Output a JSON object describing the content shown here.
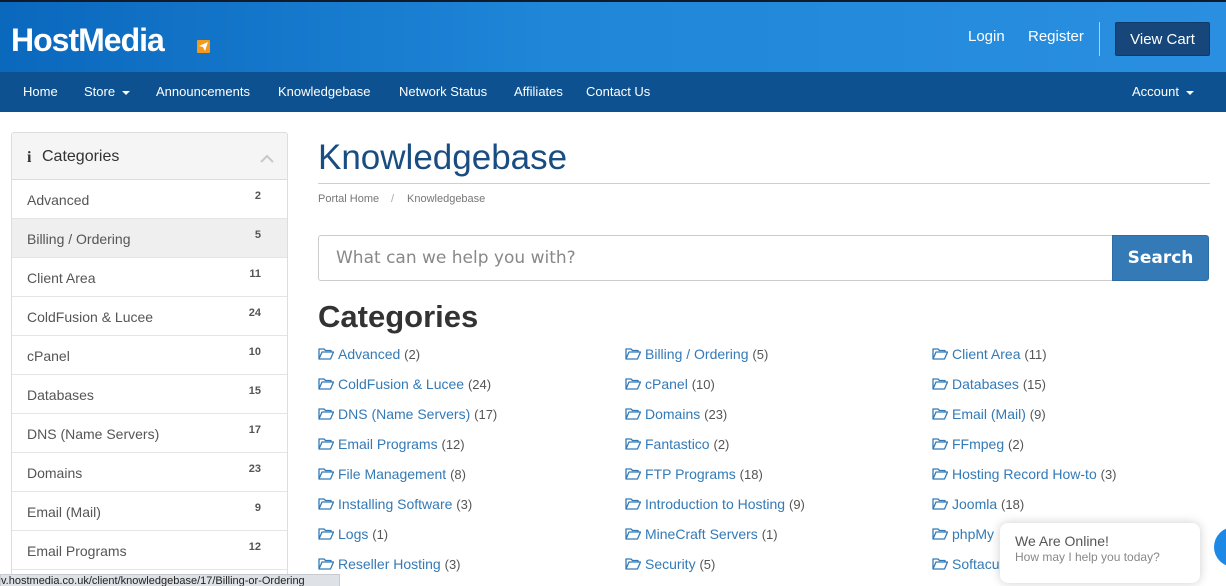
{
  "header": {
    "logo": "HostMedia",
    "login": "Login",
    "register": "Register",
    "view_cart": "View Cart"
  },
  "nav": {
    "items": [
      "Home",
      "Store",
      "Announcements",
      "Knowledgebase",
      "Network Status",
      "Affiliates",
      "Contact Us"
    ],
    "account": "Account"
  },
  "sidebar": {
    "info_glyph": "i",
    "title": "Categories",
    "items": [
      {
        "label": "Advanced",
        "count": "2"
      },
      {
        "label": "Billing / Ordering",
        "count": "5"
      },
      {
        "label": "Client Area",
        "count": "11"
      },
      {
        "label": "ColdFusion & Lucee",
        "count": "24"
      },
      {
        "label": "cPanel",
        "count": "10"
      },
      {
        "label": "Databases",
        "count": "15"
      },
      {
        "label": "DNS (Name Servers)",
        "count": "17"
      },
      {
        "label": "Domains",
        "count": "23"
      },
      {
        "label": "Email (Mail)",
        "count": "9"
      },
      {
        "label": "Email Programs",
        "count": "12"
      }
    ]
  },
  "main": {
    "title": "Knowledgebase",
    "breadcrumb": [
      "Portal Home",
      "Knowledgebase"
    ],
    "breadcrumb_sep": "/",
    "search_placeholder": "What can we help you with?",
    "search_button": "Search",
    "categories_heading": "Categories",
    "categories": [
      {
        "label": "Advanced",
        "count": "(2)"
      },
      {
        "label": "Billing / Ordering",
        "count": "(5)"
      },
      {
        "label": "Client Area",
        "count": "(11)"
      },
      {
        "label": "ColdFusion & Lucee",
        "count": "(24)"
      },
      {
        "label": "cPanel",
        "count": "(10)"
      },
      {
        "label": "Databases",
        "count": "(15)"
      },
      {
        "label": "DNS (Name Servers)",
        "count": "(17)"
      },
      {
        "label": "Domains",
        "count": "(23)"
      },
      {
        "label": "Email (Mail)",
        "count": "(9)"
      },
      {
        "label": "Email Programs",
        "count": "(12)"
      },
      {
        "label": "Fantastico",
        "count": "(2)"
      },
      {
        "label": "FFmpeg",
        "count": "(2)"
      },
      {
        "label": "File Management",
        "count": "(8)"
      },
      {
        "label": "FTP Programs",
        "count": "(18)"
      },
      {
        "label": "Hosting Record How-to",
        "count": "(3)"
      },
      {
        "label": "Installing Software",
        "count": "(3)"
      },
      {
        "label": "Introduction to Hosting",
        "count": "(9)"
      },
      {
        "label": "Joomla",
        "count": "(18)"
      },
      {
        "label": "Logs",
        "count": "(1)"
      },
      {
        "label": "MineCraft Servers",
        "count": "(1)"
      },
      {
        "label": "phpMy",
        "count": ""
      },
      {
        "label": "Reseller Hosting",
        "count": "(3)"
      },
      {
        "label": "Security",
        "count": "(5)"
      },
      {
        "label": "Softacu",
        "count": ""
      }
    ]
  },
  "chat": {
    "line1": "We Are Online!",
    "line2": "How may I help you today?"
  },
  "status_url": "v.hostmedia.co.uk/client/knowledgebase/17/Billing-or-Ordering",
  "colors": {
    "brand_blue": "#1f86d8",
    "nav_blue": "#0d5191",
    "button_blue": "#337ab7",
    "logo_accent": "#f39a1e"
  }
}
